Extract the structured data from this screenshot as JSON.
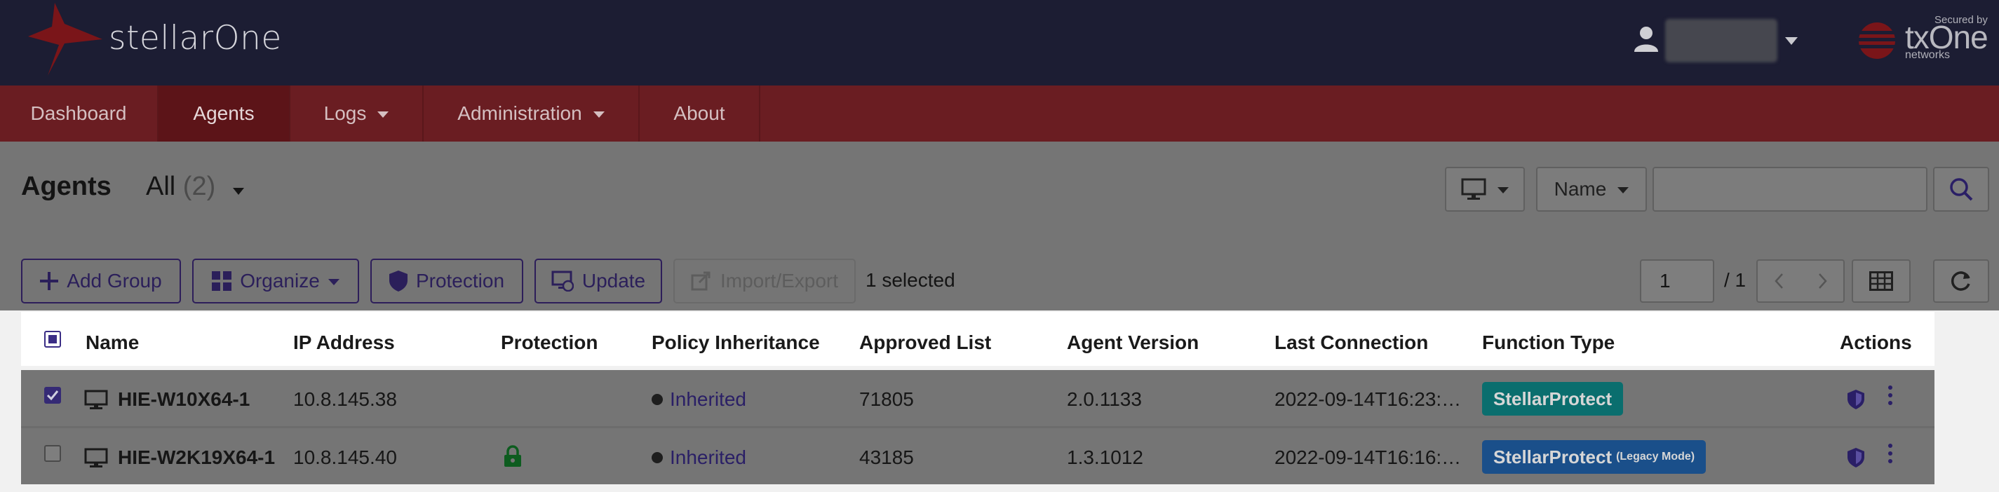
{
  "app": {
    "brand": "stellarOne",
    "secured_by": "Secured by",
    "vendor_word": "txOne",
    "vendor_sub": "networks"
  },
  "user": {
    "name": "",
    "avatar_icon": "user-icon"
  },
  "nav": {
    "items": [
      {
        "label": "Dashboard",
        "active": false,
        "caret": false
      },
      {
        "label": "Agents",
        "active": true,
        "caret": false
      },
      {
        "label": "Logs",
        "active": false,
        "caret": true
      },
      {
        "label": "Administration",
        "active": false,
        "caret": true
      },
      {
        "label": "About",
        "active": false,
        "caret": false
      }
    ]
  },
  "header": {
    "title": "Agents",
    "filter_label": "All",
    "filter_count": "(2)",
    "view_icon": "monitor-icon",
    "search_field_select": "Name",
    "search_value": "",
    "search_icon": "search-icon"
  },
  "toolbar": {
    "add_group": "Add Group",
    "organize": "Organize",
    "protection": "Protection",
    "update": "Update",
    "import_export": "Import/Export",
    "selected_text": "1 selected",
    "page_current": "1",
    "page_total": "/ 1",
    "prev_icon": "chevron-left-icon",
    "next_icon": "chevron-right-icon",
    "grid_icon": "table-icon",
    "refresh_icon": "refresh-icon"
  },
  "table": {
    "columns": [
      "Name",
      "IP Address",
      "Protection",
      "Policy Inheritance",
      "Approved List",
      "Agent Version",
      "Last Connection",
      "Function Type",
      "Actions"
    ],
    "rows": [
      {
        "checked": true,
        "name": "HIE-W10X64-1",
        "ip": "10.8.145.38",
        "protection_locked": false,
        "policy": "Inherited",
        "approved": "71805",
        "version": "2.0.1133",
        "last_conn": "2022-09-14T16:23:…",
        "function": "StellarProtect",
        "function_note": "",
        "function_color": "#0a6e6e"
      },
      {
        "checked": false,
        "name": "HIE-W2K19X64-1",
        "ip": "10.8.145.40",
        "protection_locked": true,
        "policy": "Inherited",
        "approved": "43185",
        "version": "1.3.1012",
        "last_conn": "2022-09-14T16:16:…",
        "function": "StellarProtect",
        "function_note": "(Legacy Mode)",
        "function_color": "#1a4f8a"
      }
    ]
  },
  "colors": {
    "topbar": "#1c1d33",
    "navbar": "#6a1d22",
    "accent": "#2a1f66",
    "overlay": "#757575",
    "lock": "#0d5c1f"
  }
}
